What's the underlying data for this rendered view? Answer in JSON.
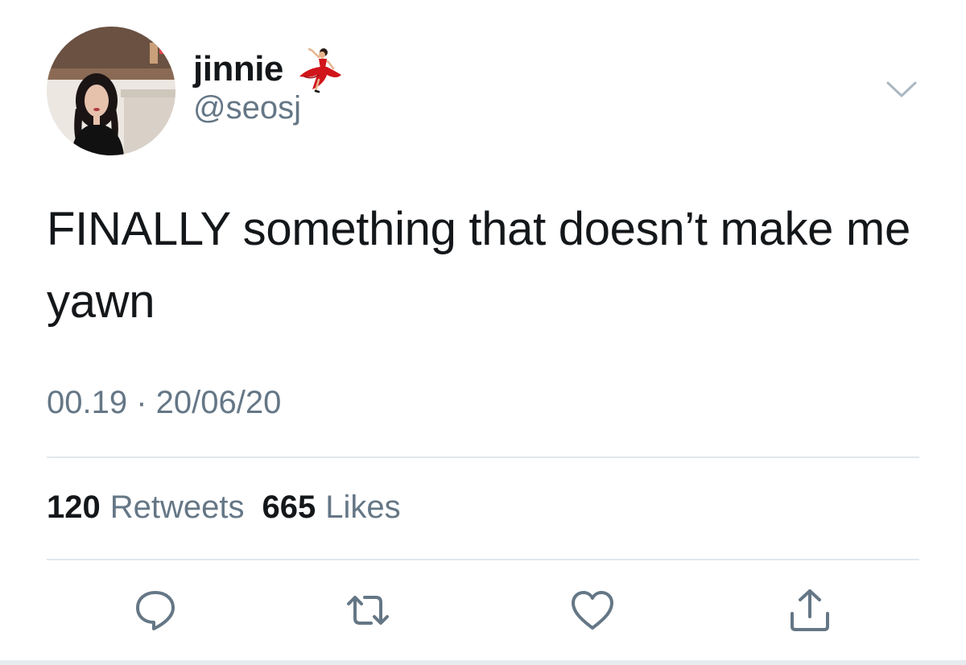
{
  "author": {
    "display_name": "jinnie",
    "handle": "@seosj",
    "name_emoji_icon": "dancer-icon"
  },
  "tweet": {
    "text": "FINALLY something that doesn’t make me yawn",
    "timestamp": "00.19 · 20/06/20"
  },
  "stats": {
    "retweets_count": "120",
    "retweets_label": "Retweets",
    "likes_count": "665",
    "likes_label": "Likes"
  },
  "actions": {
    "reply_icon": "reply-icon",
    "retweet_icon": "retweet-icon",
    "like_icon": "heart-icon",
    "share_icon": "share-icon"
  },
  "colors": {
    "text_primary": "#14171a",
    "text_secondary": "#657786",
    "divider": "#e1e8ed",
    "dancer_dress": "#d0161b"
  }
}
